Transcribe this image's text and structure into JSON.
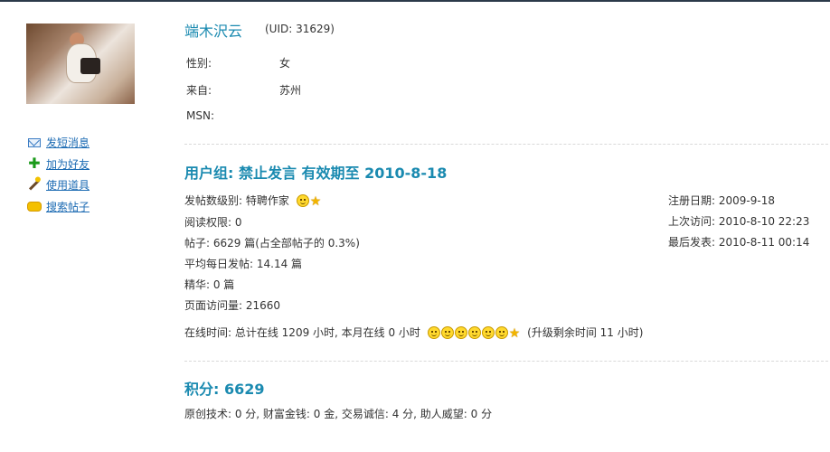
{
  "profile": {
    "username": "端木沢云",
    "uid": "(UID: 31629)",
    "info": [
      {
        "label": "性别:",
        "value": "女"
      },
      {
        "label": "来自:",
        "value": "苏州"
      },
      {
        "label": "MSN:",
        "value": ""
      }
    ]
  },
  "actions": [
    {
      "label": "发短消息",
      "icon": "envelope-icon"
    },
    {
      "label": "加为好友",
      "icon": "plus-icon"
    },
    {
      "label": "使用道具",
      "icon": "magic-wand-icon"
    },
    {
      "label": "搜索帖子",
      "icon": "chat-bubble-icon"
    }
  ],
  "group": {
    "title": "用户组: 禁止发言  有效期至  2010-8-18"
  },
  "stats": {
    "level": "发帖数级别: 特聘作家",
    "read_permission": "阅读权限: 0",
    "posts": "帖子: 6629 篇(占全部帖子的  0.3%)",
    "daily_posts": "平均每日发帖: 14.14 篇",
    "digest": "精华: 0 篇",
    "page_views": "页面访问量: 21660",
    "online_time": "在线时间: 总计在线  1209 小时, 本月在线  0 小时",
    "upgrade_remaining": "(升级剩余时间  11 小时)"
  },
  "dates": {
    "register": "注册日期: 2009-9-18",
    "last_visit": "上次访问: 2010-8-10 22:23",
    "last_post": "最后发表: 2010-8-11 00:14"
  },
  "points": {
    "title": "积分: 6629",
    "detail": "原创技术: 0 分, 财富金钱: 0 金, 交易诚信: 4 分, 助人威望: 0 分"
  },
  "icons": {
    "level_badge": [
      "smiley-icon",
      "star-icon"
    ],
    "online_badge": [
      "smiley-icon",
      "smiley-icon",
      "smiley-icon",
      "smiley-icon",
      "smiley-icon",
      "smiley-icon",
      "star-icon"
    ]
  },
  "colors": {
    "link": "#1c6bb3",
    "heading": "#1a8ab0"
  }
}
